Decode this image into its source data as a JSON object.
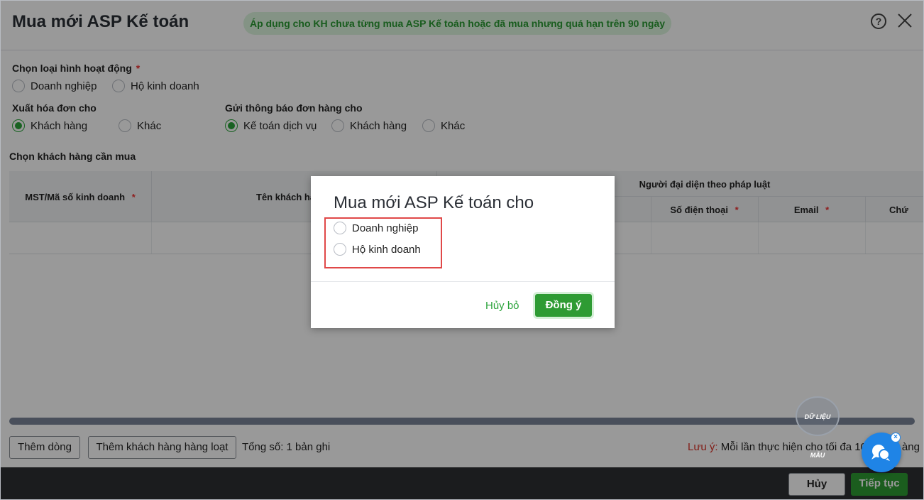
{
  "header": {
    "title": "Mua mới ASP Kế toán",
    "notice": "Áp dụng cho KH chưa từng mua ASP Kế toán hoặc đã mua nhưng quá hạn trên 90 ngày",
    "help_icon": "?"
  },
  "form": {
    "activity_type": {
      "label": "Chọn loại hình hoạt động",
      "required": "*",
      "options": [
        "Doanh nghiệp",
        "Hộ kinh doanh"
      ]
    },
    "invoice_for": {
      "label": "Xuất hóa đơn cho",
      "options": [
        "Khách hàng",
        "Khác"
      ],
      "selected": "Khách hàng"
    },
    "notify_for": {
      "label": "Gửi thông báo đơn hàng cho",
      "options": [
        "Kế toán dịch vụ",
        "Khách hàng",
        "Khác"
      ],
      "selected": "Kế toán dịch vụ"
    }
  },
  "table": {
    "title": "Chọn khách hàng cần mua",
    "columns": {
      "tax_code": "MST/Mã số kinh doanh",
      "customer_name": "Tên khách hà",
      "legal_rep": "Người đại diện theo pháp luật",
      "phone": "Số điện thoại",
      "email": "Email",
      "position": "Chứ"
    },
    "required": "*"
  },
  "bottom": {
    "add_row": "Thêm dòng",
    "bulk_add": "Thêm khách hàng hàng loạt",
    "total": "Tổng số: 1 bản ghi",
    "note_label": "Lưu ý:",
    "note_text": " Mỗi lần thực hiện cho tối đa 10",
    "note_tail": "àng",
    "stamp": "DỮ LIỆU MẪU"
  },
  "footer": {
    "cancel": "Hủy",
    "continue": "Tiếp tục"
  },
  "modal": {
    "title": "Mua mới ASP Kế toán cho",
    "options": [
      "Doanh nghiệp",
      "Hộ kinh doanh"
    ],
    "cancel": "Hủy bỏ",
    "ok": "Đồng ý"
  },
  "colors": {
    "accent": "#2aa33a",
    "notice_bg": "#dcf6de",
    "highlight": "#e04848",
    "footer_bg": "#2d2f33",
    "chat": "#1f84e6"
  }
}
